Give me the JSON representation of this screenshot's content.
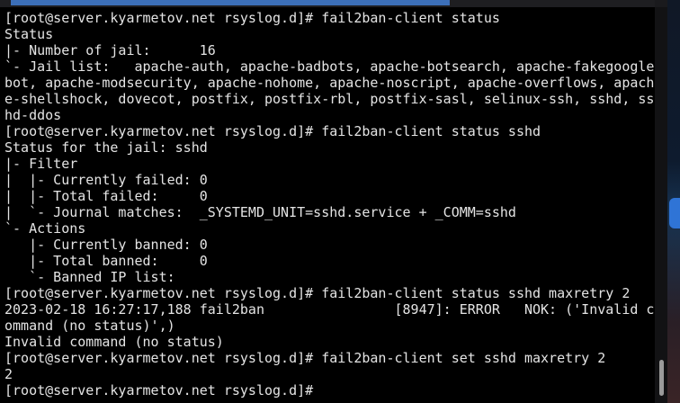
{
  "terminal": {
    "lines": [
      "[root@server.kyarmetov.net rsyslog.d]# fail2ban-client status",
      "Status",
      "|- Number of jail:      16",
      "`- Jail list:   apache-auth, apache-badbots, apache-botsearch, apache-fakegoogle",
      "bot, apache-modsecurity, apache-nohome, apache-noscript, apache-overflows, apach",
      "e-shellshock, dovecot, postfix, postfix-rbl, postfix-sasl, selinux-ssh, sshd, ss",
      "hd-ddos",
      "[root@server.kyarmetov.net rsyslog.d]# fail2ban-client status sshd",
      "Status for the jail: sshd",
      "|- Filter",
      "|  |- Currently failed: 0",
      "|  |- Total failed:     0",
      "|  `- Journal matches:  _SYSTEMD_UNIT=sshd.service + _COMM=sshd",
      "`- Actions",
      "   |- Currently banned: 0",
      "   |- Total banned:     0",
      "   `- Banned IP list:",
      "[root@server.kyarmetov.net rsyslog.d]# fail2ban-client status sshd maxretry 2",
      "2023-02-18 16:27:17,188 fail2ban                [8947]: ERROR   NOK: ('Invalid c",
      "ommand (no status)',)",
      "Invalid command (no status)",
      "[root@server.kyarmetov.net rsyslog.d]# fail2ban-client set sshd maxretry 2",
      "2"
    ],
    "prompt": "[root@server.kyarmetov.net rsyslog.d]#"
  },
  "colors": {
    "background": "#000000",
    "foreground": "#e4e4e4",
    "tab_indicator": "#3c6fb8",
    "scrollbar_thumb": "#9a9a9a"
  }
}
